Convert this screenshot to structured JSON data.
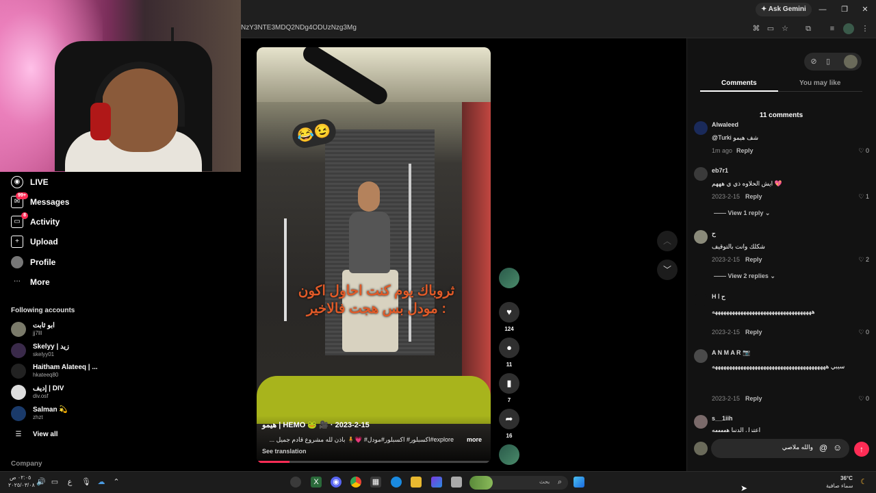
{
  "browser": {
    "url": "NzY3NTE3MDQ2NDg4ODUzNzg3Mg",
    "gemini_label": "Ask Gemini"
  },
  "sidebar": {
    "nav": [
      {
        "label": "LIVE",
        "icon": "live-icon"
      },
      {
        "label": "Messages",
        "icon": "messages-icon",
        "badge": "99+"
      },
      {
        "label": "Activity",
        "icon": "activity-icon",
        "badge": "8"
      },
      {
        "label": "Upload",
        "icon": "upload-icon"
      },
      {
        "label": "Profile",
        "icon": "profile-avatar"
      },
      {
        "label": "More",
        "icon": "more-icon"
      }
    ],
    "following_title": "Following accounts",
    "accounts": [
      {
        "name": "ابو ثابت",
        "handle": "jj7lll"
      },
      {
        "name": "Skelyy | زيد",
        "handle": "skelyy01"
      },
      {
        "name": "Haitham Alateeq | ...",
        "handle": "hkateeq80"
      },
      {
        "name": "إديف | DIV",
        "handle": "div.osf"
      },
      {
        "name": "Salman 💫",
        "handle": "zhzt"
      }
    ],
    "view_all": "View all",
    "company": "Company"
  },
  "video": {
    "emoji": "😂😉",
    "caption_line1": "ثروباك يوم كنت احاول اكون",
    "caption_line2": "مودل بس هجت فالاخير :",
    "author": "هيمو | HEMO 🐸 🎥 · 2023-2-15",
    "description": "explore#اكسبلور# اكسبلور#مودل# 💗🧍 باذن لله مشروع قادم جميل ...",
    "more": "more",
    "see_translation": "See translation",
    "progress": 0.14
  },
  "actions": {
    "likes": "124",
    "comments": "11",
    "saves": "7",
    "shares": "16"
  },
  "panel": {
    "tabs": [
      "Comments",
      "You may like"
    ],
    "count_label": "11 comments",
    "reply_label": "Reply",
    "comments": [
      {
        "user": "Alwaleed",
        "text": "@Turki شف هيمو",
        "date": "1m ago",
        "likes": "0"
      },
      {
        "user": "eb7r1",
        "text": "ايش الحلاوه ذي ي هههم 💖",
        "date": "2023-2-15",
        "likes": "1",
        "view_replies": "View 1 reply"
      },
      {
        "user": "ح",
        "text": "شكلك وانت بالتوقيف",
        "date": "2023-2-15",
        "likes": "2",
        "view_replies": "View 2 replies"
      },
      {
        "user": "H ح ا",
        "text": "هههههههههههههههههههههههههههههههههههه",
        "date": "2023-2-15",
        "likes": "0"
      },
      {
        "user": "A N M A R 📷",
        "text": "سيبي ههههههههههههههههههههههههههههههههههههههههه",
        "date": "2023-2-15",
        "likes": "0"
      },
      {
        "user": "s__1iih",
        "text": "اعتزل الدنيا هههههه",
        "date": "",
        "likes": ""
      }
    ],
    "input_value": "والله ملاصي"
  },
  "taskbar": {
    "time": "٠٢:٠٥ ص",
    "date": "٢٠٢٥/٠٣/٠٨",
    "lang": "ع",
    "search_placeholder": "بحث",
    "weather_temp": "36°C",
    "weather_desc": "سماء صافية"
  },
  "colors": {
    "accent": "#fe2c55",
    "caption": "#e05a28"
  }
}
